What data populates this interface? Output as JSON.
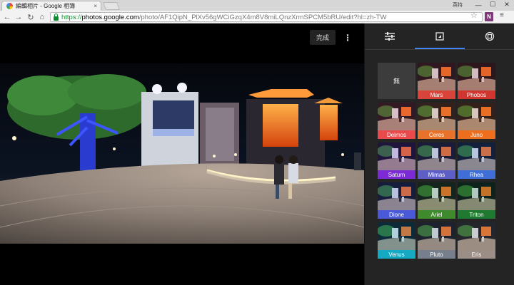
{
  "browser": {
    "tab_title": "編輯相片 - Google 相簿",
    "tab_close": "×",
    "profile_label": "英特",
    "minimize": "—",
    "maximize": "☐",
    "close": "✕",
    "back": "←",
    "forward": "→",
    "reload": "↻",
    "home": "⌂",
    "url_scheme": "https://",
    "url_host": "photos.google.com",
    "url_path": "/photo/AF1QipN_PlXv56gWCiGzqX4m8V8miLQnzXrmSPCM5bRU/edit?hl=zh-TW",
    "bookmark_star": "☆",
    "extension_label": "N",
    "menu": "≡"
  },
  "editor": {
    "done_label": "完成",
    "more_label": "⋮"
  },
  "panel": {
    "tabs": [
      {
        "icon": "sliders-icon",
        "active": false
      },
      {
        "icon": "color-filter-icon",
        "active": true
      },
      {
        "icon": "crop-rotate-icon",
        "active": false
      }
    ],
    "accent": "#4285f4"
  },
  "filters": [
    {
      "name": "無",
      "color": "#3c3c3c"
    },
    {
      "name": "Mars",
      "color": "#d8433a"
    },
    {
      "name": "Phobos",
      "color": "#d0352f"
    },
    {
      "name": "Deimos",
      "color": "#ea4a4c"
    },
    {
      "name": "Ceres",
      "color": "#e8722a"
    },
    {
      "name": "Juno",
      "color": "#ed6e1c"
    },
    {
      "name": "Saturn",
      "color": "#7b2ad6"
    },
    {
      "name": "Mimas",
      "color": "#5e5ec7"
    },
    {
      "name": "Rhea",
      "color": "#3f6fd6"
    },
    {
      "name": "Dione",
      "color": "#4a59d8"
    },
    {
      "name": "Ariel",
      "color": "#3f8a2c"
    },
    {
      "name": "Triton",
      "color": "#1f7a2f"
    },
    {
      "name": "Venus",
      "color": "#15a9c4"
    },
    {
      "name": "Pluto",
      "color": "#777e8c"
    },
    {
      "name": "Eris",
      "color": "#9a8e86"
    }
  ]
}
